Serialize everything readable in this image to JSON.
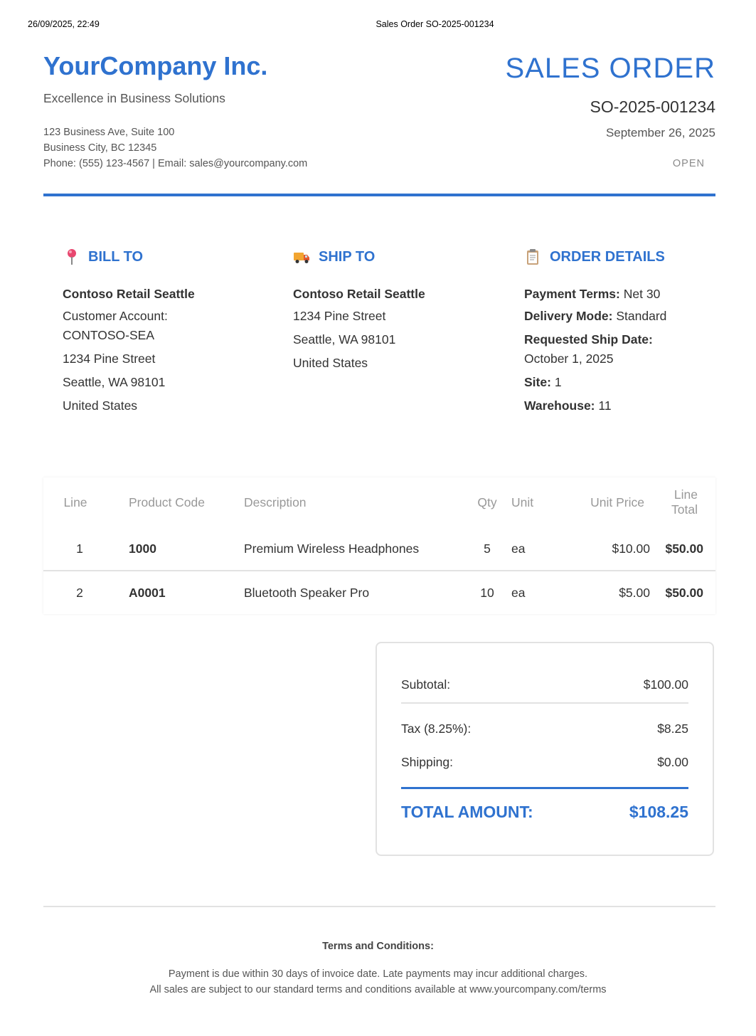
{
  "print_header": {
    "timestamp": "26/09/2025, 22:49",
    "title": "Sales Order SO-2025-001234"
  },
  "company": {
    "name": "YourCompany Inc.",
    "tagline": "Excellence in Business Solutions",
    "address_line1": "123 Business Ave, Suite 100",
    "address_line2": "Business City, BC 12345",
    "contact": "Phone: (555) 123-4567 | Email: sales@yourcompany.com"
  },
  "order_header": {
    "title": "SALES ORDER",
    "number": "SO-2025-001234",
    "date": "September 26, 2025",
    "status": "OPEN"
  },
  "bill_to": {
    "heading": "BILL TO",
    "icon": "pushpin-icon",
    "name": "Contoso Retail Seattle",
    "account_label": "Customer Account:",
    "account_value": "CONTOSO-SEA",
    "street": "1234 Pine Street",
    "city": "Seattle, WA 98101",
    "country": "United States"
  },
  "ship_to": {
    "heading": "SHIP TO",
    "icon": "delivery-truck-icon",
    "name": "Contoso Retail Seattle",
    "street": "1234 Pine Street",
    "city": "Seattle, WA 98101",
    "country": "United States"
  },
  "order_details": {
    "heading": "ORDER DETAILS",
    "icon": "clipboard-icon",
    "payment_terms_label": "Payment Terms:",
    "payment_terms_value": "Net 30",
    "delivery_mode_label": "Delivery Mode:",
    "delivery_mode_value": "Standard",
    "requested_ship_label": "Requested Ship Date:",
    "requested_ship_value": "October 1, 2025",
    "site_label": "Site:",
    "site_value": "1",
    "warehouse_label": "Warehouse:",
    "warehouse_value": "11"
  },
  "items_table": {
    "columns": [
      "Line",
      "Product Code",
      "Description",
      "Qty",
      "Unit",
      "Unit Price",
      "Line Total"
    ],
    "rows": [
      {
        "line": "1",
        "code": "1000",
        "description": "Premium Wireless Headphones",
        "qty": "5",
        "unit": "ea",
        "unit_price": "$10.00",
        "line_total": "$50.00"
      },
      {
        "line": "2",
        "code": "A0001",
        "description": "Bluetooth Speaker Pro",
        "qty": "10",
        "unit": "ea",
        "unit_price": "$5.00",
        "line_total": "$50.00"
      }
    ]
  },
  "totals": {
    "subtotal_label": "Subtotal:",
    "subtotal_value": "$100.00",
    "tax_label": "Tax (8.25%):",
    "tax_value": "$8.25",
    "shipping_label": "Shipping:",
    "shipping_value": "$0.00",
    "total_label": "TOTAL AMOUNT:",
    "total_value": "$108.25"
  },
  "footer": {
    "terms_title": "Terms and Conditions:",
    "terms_line1": "Payment is due within 30 days of invoice date. Late payments may incur additional charges.",
    "terms_line2": "All sales are subject to our standard terms and conditions available at www.yourcompany.com/terms"
  },
  "colors": {
    "accent": "#2f72cf",
    "text": "#333333",
    "muted": "#999999",
    "border": "#e2e2e2"
  }
}
